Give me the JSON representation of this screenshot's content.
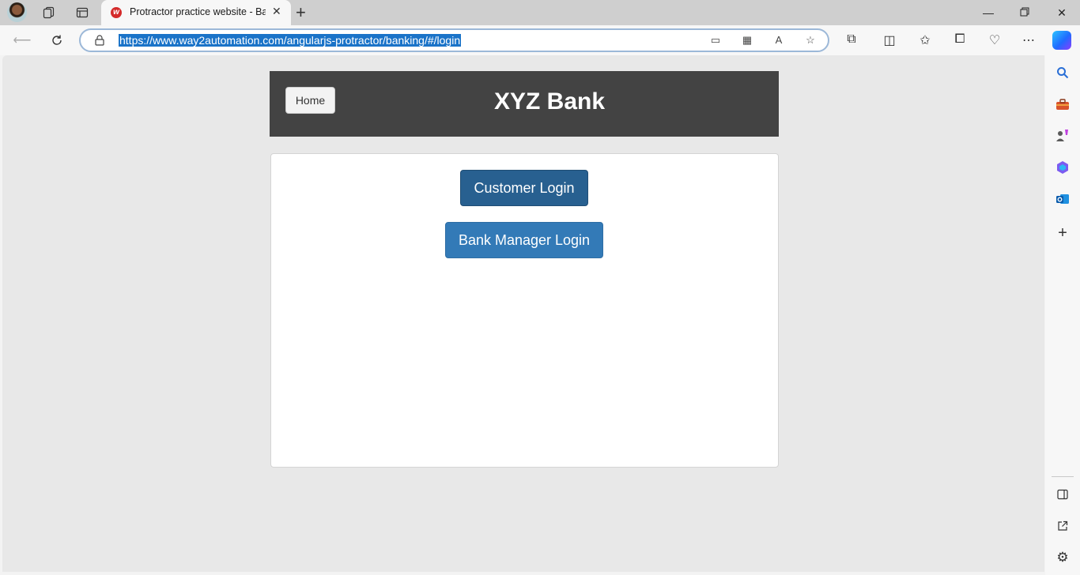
{
  "browser": {
    "tab_title": "Protractor practice website - Ban",
    "url": "https://www.way2automation.com/angularjs-protractor/banking/#/login",
    "new_tab_symbol": "+",
    "close_symbol": "✕"
  },
  "page": {
    "home_label": "Home",
    "bank_title": "XYZ Bank",
    "customer_login_label": "Customer Login",
    "manager_login_label": "Bank Manager Login"
  },
  "colors": {
    "header_bg": "#434343",
    "customer_button": "#286090",
    "manager_button": "#337ab7",
    "url_selection": "#1a73c8"
  }
}
